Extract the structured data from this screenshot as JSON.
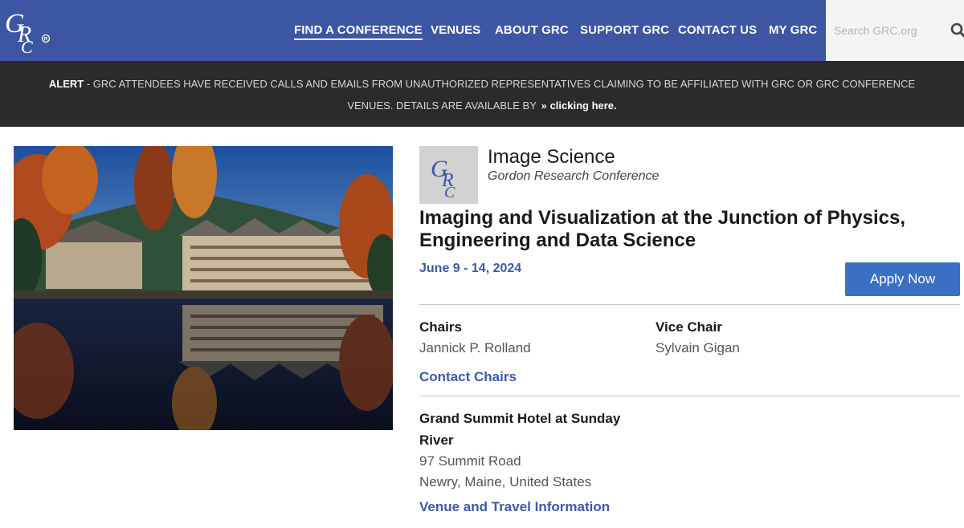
{
  "header": {
    "logo_text": "GRC",
    "nav": [
      {
        "label": "FIND A CONFERENCE",
        "active": true
      },
      {
        "label": "VENUES",
        "active": false
      },
      {
        "label": "ABOUT GRC",
        "active": false
      },
      {
        "label": "SUPPORT GRC",
        "active": false
      },
      {
        "label": "CONTACT US",
        "active": false
      },
      {
        "label": "MY GRC",
        "active": false
      }
    ],
    "search_placeholder": "Search GRC.org",
    "search_icon": "search-icon",
    "brand_color": "#3d56a3"
  },
  "alert": {
    "label": "ALERT",
    "line1": " - GRC ATTENDEES HAVE RECEIVED CALLS AND EMAILS FROM UNAUTHORIZED REPRESENTATIVES CLAIMING TO BE AFFILIATED WITH GRC OR GRC CONFERENCE",
    "line2": "VENUES. DETAILS ARE AVAILABLE BY",
    "link_text": "clicking here.",
    "link_icon": "double-chevron-right-icon"
  },
  "conference": {
    "logo_text": "GRC",
    "title": "Image Science",
    "subtitle": "Gordon Research Conference",
    "headline": "Imaging and Visualization at the Junction of Physics, Engineering and Data Science",
    "dates": "June 9 - 14, 2024",
    "apply_label": "Apply Now",
    "chairs_label": "Chairs",
    "chairs_value": "Jannick P. Rolland",
    "vice_chair_label": "Vice Chair",
    "vice_chair_value": "Sylvain Gigan",
    "contact_chairs_label": "Contact Chairs",
    "venue_name": "Grand Summit Hotel at Sunday River",
    "venue_address1": "97 Summit Road",
    "venue_address2": "Newry, Maine, United States",
    "venue_link_label": "Venue and Travel Information",
    "accent_color": "#3d5aa8",
    "button_color": "#3b6fc4"
  }
}
